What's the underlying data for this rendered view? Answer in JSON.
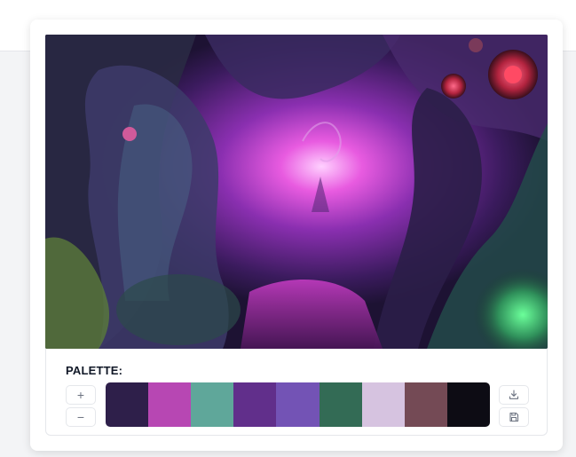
{
  "palette": {
    "title": "PALETTE:",
    "zoom_in_label": "+",
    "zoom_out_label": "−",
    "colors": [
      {
        "hex": "#2e1f4a"
      },
      {
        "hex": "#b747b3"
      },
      {
        "hex": "#5fa79a"
      },
      {
        "hex": "#612f8b"
      },
      {
        "hex": "#7353b5"
      },
      {
        "hex": "#336b55"
      },
      {
        "hex": "#d6c3e0"
      },
      {
        "hex": "#744a55"
      },
      {
        "hex": "#0d0c14"
      }
    ]
  },
  "icons": {
    "download": "download-icon",
    "save": "save-icon"
  }
}
